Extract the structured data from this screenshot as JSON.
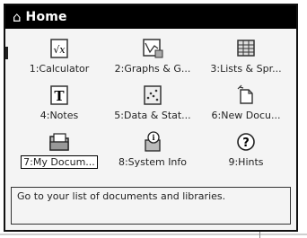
{
  "header": {
    "title": "Home",
    "icon": "home-icon"
  },
  "apps": [
    {
      "label": "1:Calculator",
      "icon": "calculator-icon"
    },
    {
      "label": "2:Graphs & G...",
      "icon": "graphs-icon"
    },
    {
      "label": "3:Lists & Spr...",
      "icon": "spreadsheet-icon"
    },
    {
      "label": "4:Notes",
      "icon": "notes-icon"
    },
    {
      "label": "5:Data & Stat...",
      "icon": "data-stats-icon"
    },
    {
      "label": "6:New Docu...",
      "icon": "new-document-icon"
    },
    {
      "label": "7:My Docum...",
      "icon": "folder-icon",
      "selected": true
    },
    {
      "label": "8:System Info",
      "icon": "system-info-icon"
    },
    {
      "label": "9:Hints",
      "icon": "hints-icon"
    }
  ],
  "status": {
    "text": "Go to your list of documents and libraries."
  }
}
